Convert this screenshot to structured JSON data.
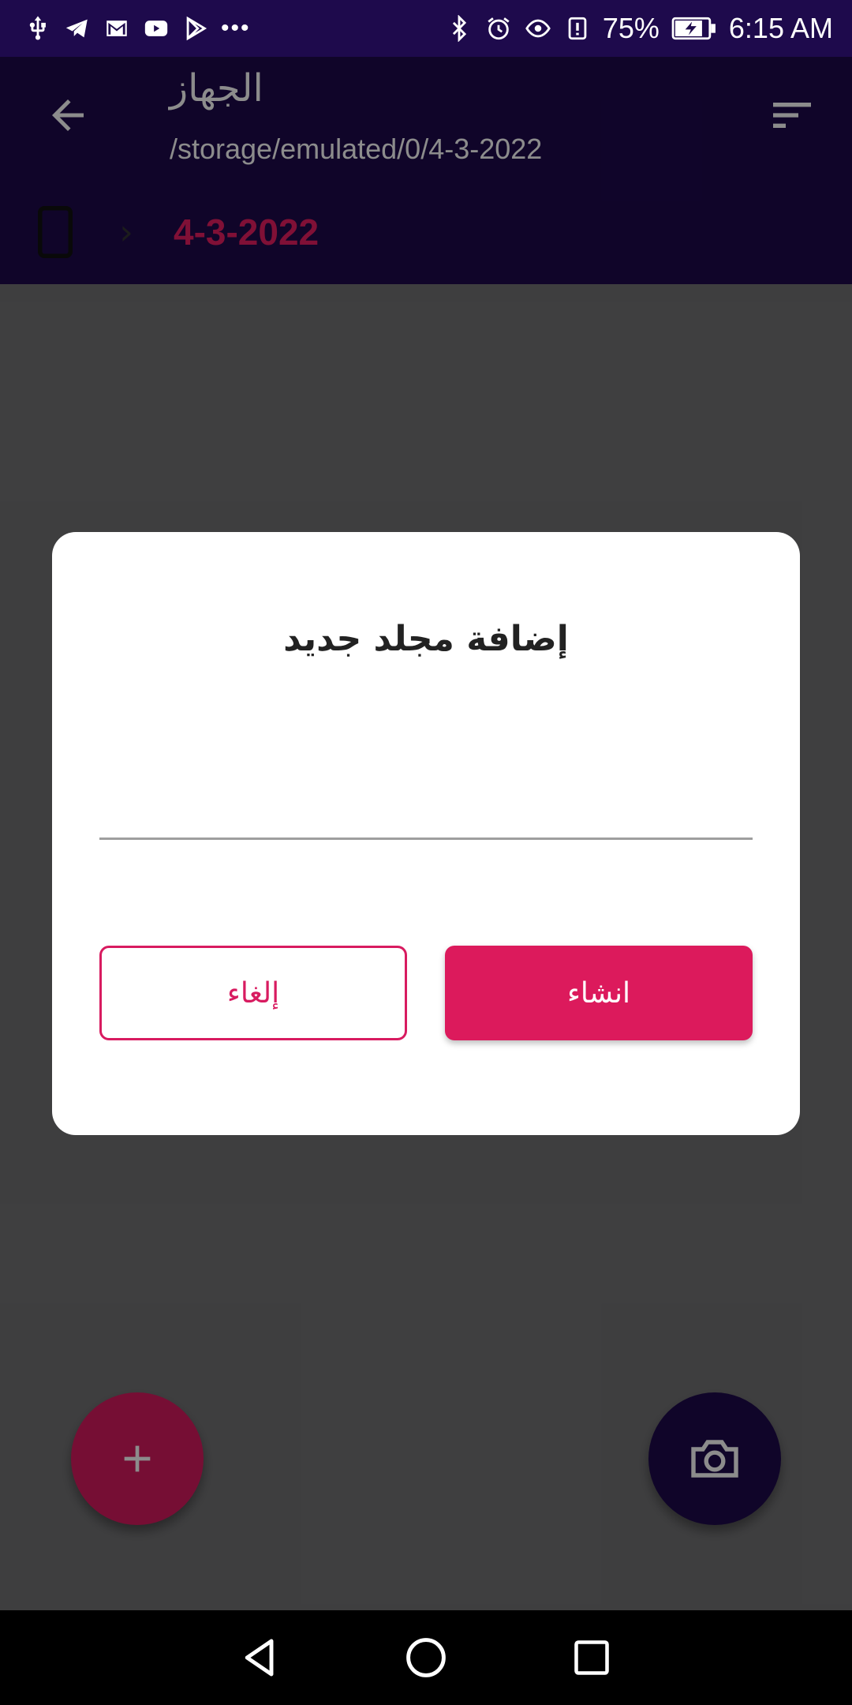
{
  "status_bar": {
    "left_icons": [
      "usb-icon",
      "telegram-icon",
      "gmail-icon",
      "youtube-icon",
      "play-store-icon"
    ],
    "more_indicator": "•••",
    "right_icons": [
      "bluetooth-icon",
      "alarm-icon",
      "eye-comfort-icon",
      "battery-alert-icon"
    ],
    "battery_percent": "75%",
    "time": "6:15 AM"
  },
  "app_bar": {
    "title": "الجهاز",
    "path": "/storage/emulated/0/4-3-2022",
    "breadcrumb": {
      "separator": "›",
      "current": "4-3-2022"
    }
  },
  "dialog": {
    "title": "إضافة مجلد جديد",
    "input_value": "",
    "cancel_label": "إلغاء",
    "create_label": "انشاء"
  },
  "fab": {
    "add_icon": "plus-icon",
    "camera_icon": "camera-icon"
  },
  "colors": {
    "primary_dark": "#1e0a4c",
    "accent": "#d81b60"
  }
}
